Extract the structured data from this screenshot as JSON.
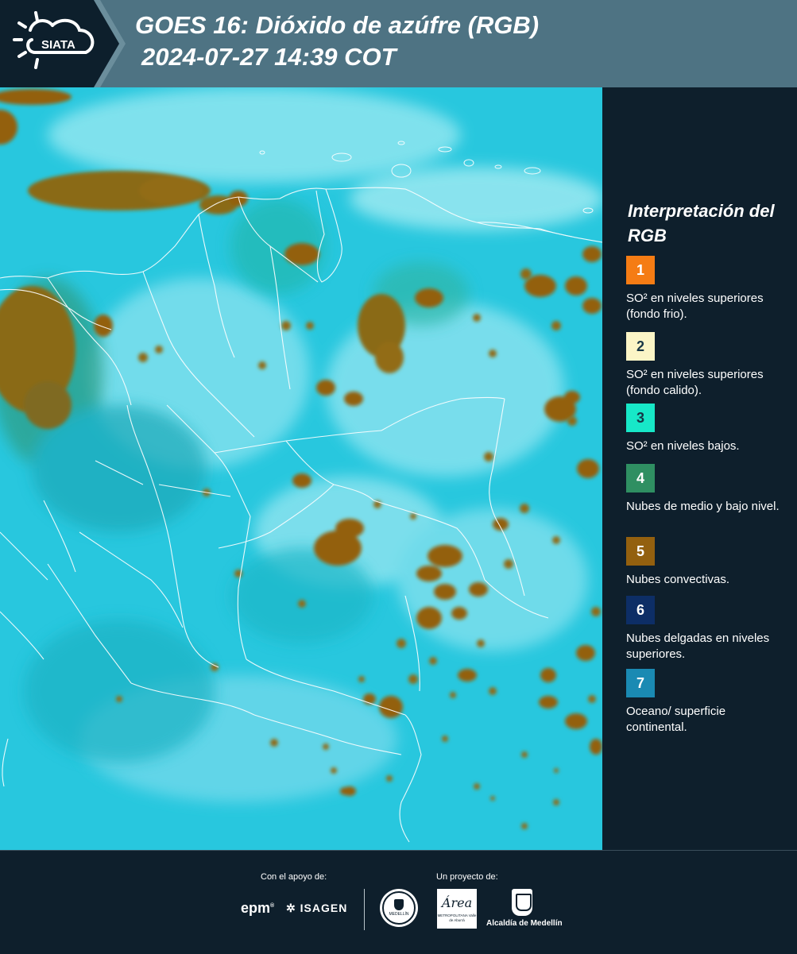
{
  "header": {
    "title_line1": "GOES 16: Dióxido de azúfre (RGB)",
    "title_line2": "2024-07-27 14:39 COT",
    "logo_text": "SIATA"
  },
  "legend": {
    "title": "Interpretación del RGB",
    "items": [
      {
        "number": "1",
        "label": "SO² en niveles superiores (fondo frio).",
        "color": "#f57c14"
      },
      {
        "number": "2",
        "label": "SO² en niveles superiores (fondo calido).",
        "color": "#fbf5c6"
      },
      {
        "number": "3",
        "label": "SO² en niveles bajos.",
        "color": "#17e8c8"
      },
      {
        "number": "4",
        "label": "Nubes de medio y bajo nivel.",
        "color": "#2f8f62"
      },
      {
        "number": "5",
        "label": "Nubes convectivas.",
        "color": "#93600f"
      },
      {
        "number": "6",
        "label": "Nubes delgadas en niveles superiores.",
        "color": "#0d2e66"
      },
      {
        "number": "7",
        "label": "Oceano/ superficie continental.",
        "color": "#1a8ab3"
      }
    ]
  },
  "footer": {
    "support_label": "Con el apoyo de:",
    "project_label": "Un proyecto de:",
    "epm": "epm",
    "isagen": "ISAGEN",
    "area_logo": "Área",
    "area_caption": "METROPOLITANA Valle de Aburrá",
    "alcaldia": "Alcaldía de Medellín",
    "seal_text": "MEDELLÍN"
  },
  "colors": {
    "background": "#0e1f2c",
    "header": "#4e7383",
    "map_base": "#25c6dd",
    "convective": "#93600f",
    "border_lines": "#ffffff"
  },
  "icons": [
    "sun-cloud-logo-icon",
    "epm-logo",
    "isagen-logo",
    "medellin-seal",
    "area-metropolitana-logo",
    "alcaldia-logo"
  ]
}
